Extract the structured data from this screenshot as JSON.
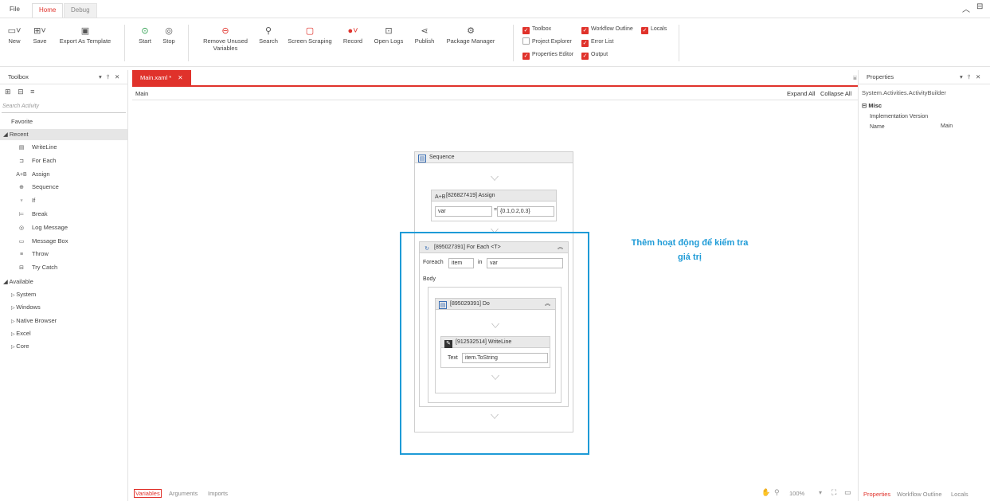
{
  "menu": {
    "file": "File",
    "home": "Home",
    "debug": "Debug"
  },
  "ribbon": {
    "new": "New",
    "save": "Save",
    "export": "Export As Template",
    "start": "Start",
    "stop": "Stop",
    "remove_unused_1": "Remove Unused",
    "remove_unused_2": "Variables",
    "search": "Search",
    "screen_scraping": "Screen Scraping",
    "record": "Record",
    "open_logs": "Open Logs",
    "publish": "Publish",
    "package_manager": "Package Manager",
    "checks": {
      "toolbox": "Toolbox",
      "workflow_outline": "Workflow Outline",
      "locals": "Locals",
      "project_explorer": "Project Explorer",
      "error_list": "Error List",
      "properties_editor": "Properties Editor",
      "output": "Output"
    }
  },
  "toolbox": {
    "title": "Toolbox",
    "search_placeholder": "Search Activity",
    "favorite": "Favorite",
    "recent": "Recent",
    "recent_items": [
      "WriteLine",
      "For Each",
      "Assign",
      "Sequence",
      "If",
      "Break",
      "Log Message",
      "Message Box",
      "Throw",
      "Try Catch"
    ],
    "available": "Available",
    "available_items": [
      "System",
      "Windows",
      "Native Browser",
      "Excel",
      "Core"
    ]
  },
  "designer": {
    "tab": "Main.xaml *",
    "breadcrumb": "Main",
    "expand_all": "Expand All",
    "collapse_all": "Collapse All",
    "sequence_title": "Sequence",
    "assign_title": "[826827419] Assign",
    "assign_to": "var",
    "assign_value": "{0.1,0.2,0.3}",
    "foreach_title": "[895027391] For Each <T>",
    "foreach_label": "Foreach",
    "foreach_item": "item",
    "in_label": "in",
    "foreach_values": "var",
    "body_label": "Body",
    "do_title": "[895029391] Do",
    "writeline_title": "[912532514] WriteLine",
    "text_label": "Text",
    "text_value": "item.ToString",
    "annotation_1": "Thêm hoạt động để kiểm tra",
    "annotation_2": "giá trị",
    "annotation_color": "#1e9bd7",
    "bottom_tabs": [
      "Variables",
      "Arguments",
      "Imports"
    ],
    "zoom": "100%"
  },
  "properties": {
    "title": "Properties",
    "type": "System.Activities.ActivityBuilder",
    "category": "Misc",
    "rows": [
      {
        "name": "Implementation Version",
        "value": ""
      },
      {
        "name": "Name",
        "value": "Main"
      }
    ],
    "bottom_tabs": [
      "Properties",
      "Workflow Outline",
      "Locals"
    ]
  }
}
